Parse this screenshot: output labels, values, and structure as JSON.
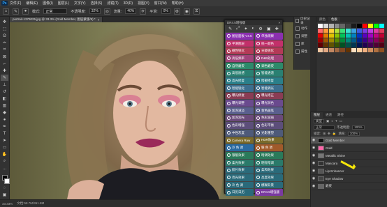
{
  "menu": {
    "logo": "Ps",
    "items": [
      "文件(F)",
      "编辑(E)",
      "图像(I)",
      "图层(L)",
      "文字(Y)",
      "选择(S)",
      "滤镜(T)",
      "3D(D)",
      "视图(V)",
      "窗口(W)",
      "帮助(H)"
    ]
  },
  "options": {
    "mode_label": "模式:",
    "mode_value": "正常",
    "opacity_label": "不透明度:",
    "opacity_value": "32%",
    "flow_label": "流量:",
    "flow_value": "40%",
    "smooth_label": "平滑:",
    "smooth_value": "0%"
  },
  "document": {
    "tab_title": "portrait-1379025.jpg @ 33.3% (Gold Member, 图层蒙版/8) *",
    "close": "×",
    "status_zoom": "33.33%",
    "status_doc": "文档:58.7M/361.8M"
  },
  "plugin": {
    "title": "DR4.5增强版",
    "close": "»",
    "toolbar_icons": [
      "✎",
      "⤢",
      "✦",
      "◐",
      "⚙",
      "▣",
      "✚"
    ],
    "buttons": [
      {
        "label": "图层面板 V4.5",
        "color": "#8b2fb0"
      },
      {
        "label": "单独观察",
        "color": "#8b2fb0"
      },
      {
        "label": "平滑图层",
        "color": "#c2306a"
      },
      {
        "label": "统一颜色",
        "color": "#c2306a"
      },
      {
        "label": "磁性锐化",
        "color": "#b43a57"
      },
      {
        "label": "分级锐化",
        "color": "#b43a57"
      },
      {
        "label": "高低频率",
        "color": "#a0437a"
      },
      {
        "label": "D&B处理",
        "color": "#a0437a"
      },
      {
        "label": "自然磨皮",
        "color": "#2d8a6a"
      },
      {
        "label": "调色磨皮",
        "color": "#2d8a6a"
      },
      {
        "label": "高低质感",
        "color": "#2a8072"
      },
      {
        "label": "智能通道",
        "color": "#2a8072"
      },
      {
        "label": "高光修复",
        "color": "#2a7f8a"
      },
      {
        "label": "暗部修复",
        "color": "#2a7f8a"
      },
      {
        "label": "智能锐化",
        "color": "#3c6e8e"
      },
      {
        "label": "智能调光",
        "color": "#3c6e8e"
      },
      {
        "label": "曝光修复",
        "color": "#8a3c54"
      },
      {
        "label": "曝光修正",
        "color": "#8a3c54"
      },
      {
        "label": "曝光调整",
        "color": "#6a4a8e"
      },
      {
        "label": "曝光润色",
        "color": "#6a4a8e"
      },
      {
        "label": "加深减淡",
        "color": "#5a5f8e"
      },
      {
        "label": "金色画笔",
        "color": "#5a5f8e"
      },
      {
        "label": "加深润光",
        "color": "#6b4a7a"
      },
      {
        "label": "色彩减弱",
        "color": "#6b4a7a"
      },
      {
        "label": "色彩增强",
        "color": "#5c4e7a"
      },
      {
        "label": "色彩平衡",
        "color": "#5c4e7a"
      },
      {
        "label": "中性灰度",
        "color": "#4e5a7a"
      },
      {
        "label": "光影重塑",
        "color": "#4e5a7a"
      },
      {
        "label": "Camera Raw",
        "color": "#7a6a2a"
      },
      {
        "label": "HDR效果",
        "color": "#7a6a2a"
      },
      {
        "label": "冷 色 调",
        "color": "#2a6aa0"
      },
      {
        "label": "暖 色 调",
        "color": "#a05a2a"
      },
      {
        "label": "银版效果",
        "color": "#2a7a5a"
      },
      {
        "label": "暗调效果",
        "color": "#2a7a5a"
      },
      {
        "label": "柔光效果",
        "color": "#2a7a6a"
      },
      {
        "label": "明亮暗调",
        "color": "#2a7a6a"
      },
      {
        "label": "胶片效果",
        "color": "#2a6a7a"
      },
      {
        "label": "柔和效果",
        "color": "#2a6a7a"
      },
      {
        "label": "亮光效果",
        "color": "#2a6a7a"
      },
      {
        "label": "高度效果",
        "color": "#2a6a7a"
      },
      {
        "label": "冷 色 调",
        "color": "#2a6a7a"
      },
      {
        "label": "模糊背景",
        "color": "#2a6a7a"
      },
      {
        "label": "日历日历",
        "color": "#2a6a7a"
      },
      {
        "label": "DR4.5增强版",
        "color": "#7a3aa0"
      }
    ]
  },
  "history": {
    "items": [
      "历史记录",
      "动作",
      "调整",
      "库",
      "属性"
    ]
  },
  "swatches_panel": {
    "tabs": [
      "颜色",
      "色板"
    ],
    "colors": [
      "#ffffff",
      "#d9d9d9",
      "#b3b3b3",
      "#8c8c8c",
      "#666666",
      "#404040",
      "#1a1a1a",
      "#000000",
      "#ff0000",
      "#ffff00",
      "#00ff00",
      "#00ffff",
      "#ff6a6a",
      "#ff9a3a",
      "#ffd23a",
      "#b5e23a",
      "#3ae27a",
      "#3ae2d2",
      "#3aa2e2",
      "#3a5ae2",
      "#7a3ae2",
      "#c23ae2",
      "#e23aa2",
      "#e23a5a",
      "#e20000",
      "#e27a00",
      "#e2c200",
      "#8ac200",
      "#00c25a",
      "#00c2b2",
      "#0082c2",
      "#0032c2",
      "#5a00c2",
      "#a200c2",
      "#c20082",
      "#c20032",
      "#a00000",
      "#a05600",
      "#a08a00",
      "#5a8a00",
      "#008a3a",
      "#008a7a",
      "#005a8a",
      "#00228a",
      "#3a008a",
      "#72008a",
      "#8a005a",
      "#8a0022",
      "#600000",
      "#603300",
      "#605200",
      "#365200",
      "#005222",
      "#005248",
      "#003652",
      "#001452",
      "#220052",
      "#440052",
      "#520036",
      "#520014",
      "#f2c8a2",
      "#e2a882",
      "#c28862",
      "#a26842",
      "#824822",
      "#623202",
      "#ffe0c0",
      "#ffd0a0",
      "#f0b080",
      "#d09060",
      "#b07040",
      "#905020"
    ]
  },
  "layers_panel": {
    "tabs": [
      "图层",
      "通道",
      "路径"
    ],
    "kind_label": "类型",
    "blend_value": "正常",
    "opacity_label": "不透明度:",
    "opacity_value": "100%",
    "lock_label": "锁定:",
    "fill_label": "填充:",
    "fill_value": "100%",
    "rows": [
      {
        "name": "Gold Member",
        "selected": true,
        "thumb": "#111111"
      },
      {
        "name": "Gold",
        "selected": false,
        "thumb": "#ff66aa"
      },
      {
        "name": "Metallic Shine",
        "selected": false,
        "thumb": "#777777"
      },
      {
        "name": "Mascara",
        "selected": false,
        "thumb": "#333333"
      },
      {
        "name": "Lip Enhancer",
        "selected": false,
        "thumb": "#555555"
      },
      {
        "name": "Eye Shadow",
        "selected": false,
        "thumb": "#444444"
      },
      {
        "name": "磨皮",
        "selected": false,
        "thumb": "#666666"
      }
    ]
  },
  "colors": {
    "accent": "#31a8ff",
    "highlight": "#f5e60a",
    "selection": "#545454"
  }
}
